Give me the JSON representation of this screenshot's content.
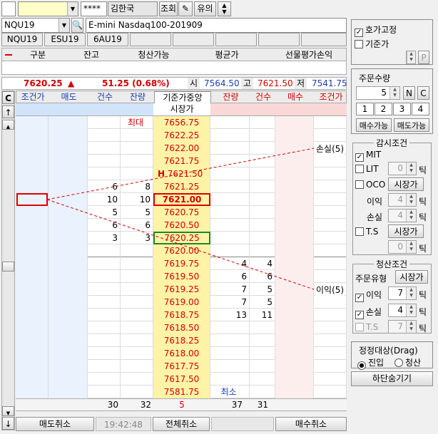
{
  "toolbar": {
    "account": "",
    "password": "****",
    "name": "김한국",
    "query": "조회",
    "notice": "유의"
  },
  "product": {
    "code": "NQU19",
    "desc": "E-mini Nasdaq100-201909",
    "tabs": [
      "NQU19",
      "ESU19",
      "6AU19",
      "",
      "",
      "",
      "",
      "",
      ""
    ]
  },
  "position_header": {
    "c1": "구분",
    "c2": "잔고",
    "c3": "청산가능",
    "c4": "평균가",
    "c5": "선물평가손익"
  },
  "quote": {
    "price": "7620.25",
    "arrow": "▲",
    "change": "51.25 (0.68%)",
    "open_label": "시",
    "open": "7564.50",
    "high_label": "고",
    "high": "7621.50",
    "low_label": "저",
    "low": "7541.75"
  },
  "grid_header": {
    "cond": "조건가",
    "sell": "매도",
    "cnt": "건수",
    "rem": "잔량",
    "ref": "기준가중앙",
    "rem2": "잔량",
    "cnt2": "건수",
    "buy": "매수",
    "cond2": "조건가",
    "corner": "C",
    "up": "↑",
    "down": "↓",
    "market": "시장가"
  },
  "rows": [
    {
      "rem": "최대",
      "price": "7656.75",
      "rem2": "",
      "cnt2": ""
    },
    {
      "rem": "",
      "price": "7622.25",
      "rem2": "",
      "cnt2": ""
    },
    {
      "rem": "",
      "price": "7622.00",
      "rem2": "",
      "cnt2": ""
    },
    {
      "rem": "",
      "price": "7621.75",
      "rem2": "",
      "cnt2": ""
    },
    {
      "rem": "",
      "price": "7621.50",
      "mark": "H",
      "rem2": "",
      "cnt2": ""
    },
    {
      "cnt": "6",
      "rem": "8",
      "price": "7621.25",
      "rem2": "",
      "cnt2": ""
    },
    {
      "cnt": "10",
      "rem": "10",
      "price": "7621.00",
      "rem2": "",
      "cnt2": ""
    },
    {
      "cnt": "5",
      "rem": "5",
      "price": "7620.75",
      "rem2": "",
      "cnt2": ""
    },
    {
      "cnt": "6",
      "rem": "6",
      "price": "7620.50",
      "rem2": "",
      "cnt2": ""
    },
    {
      "cnt": "3",
      "rem": "3",
      "price": "7620.25",
      "rem2": "",
      "cnt2": ""
    },
    {
      "cnt": "",
      "rem": "",
      "price": "7620.00",
      "rem2": "",
      "cnt2": ""
    },
    {
      "price": "7619.75",
      "rem2": "4",
      "cnt2": "4"
    },
    {
      "price": "7619.50",
      "rem2": "6",
      "cnt2": "6"
    },
    {
      "price": "7619.25",
      "rem2": "7",
      "cnt2": "5"
    },
    {
      "price": "7619.00",
      "rem2": "7",
      "cnt2": "5"
    },
    {
      "price": "7618.75",
      "rem2": "13",
      "cnt2": "11"
    },
    {
      "price": "7618.50",
      "rem2": "",
      "cnt2": ""
    },
    {
      "price": "7618.25",
      "rem2": "",
      "cnt2": ""
    },
    {
      "price": "7618.00",
      "rem2": "",
      "cnt2": ""
    },
    {
      "price": "7617.75",
      "rem2": "",
      "cnt2": ""
    },
    {
      "price": "7617.50",
      "rem2": "",
      "cnt2": ""
    },
    {
      "price": "7581.75",
      "rem2": "최소",
      "cnt2": ""
    }
  ],
  "totals": {
    "cnt": "30",
    "rem": "32",
    "mid": "5",
    "rem2": "37",
    "cnt2": "31"
  },
  "bottom": {
    "sell_cancel": "매도취소",
    "time": "19:42:48",
    "all_cancel": "전체취소",
    "buy_cancel": "매수취소"
  },
  "annotations": {
    "loss": "손실(5)",
    "profit": "이익(5)"
  },
  "side": {
    "fix_quote": "호가고정",
    "base_price": "기준가",
    "p_btn": "P",
    "qty_title": "주문수량",
    "qty": "5",
    "n_btn": "N",
    "c_btn": "C",
    "presets": [
      "1",
      "2",
      "3",
      "4"
    ],
    "buy_avail": "매수가능",
    "sell_avail": "매도가능",
    "watch_title": "감시조건",
    "mit": "MIT",
    "lit": "LIT",
    "oco": "OCO",
    "ts": "T.S",
    "market": "시장가",
    "tick": "틱",
    "lit_val": "0",
    "profit_label": "이익",
    "profit_val": "4",
    "loss_label": "손실",
    "loss_val": "4",
    "ts_val": "0",
    "liq_title": "청산조건",
    "order_type": "주문유형",
    "order_type_val": "시장가",
    "liq_profit": "이익",
    "liq_profit_val": "7",
    "liq_loss": "손실",
    "liq_loss_val": "4",
    "liq_ts": "T.S",
    "liq_ts_val": "7",
    "drag_title": "정정대상(Drag)",
    "entry": "진입",
    "exit": "청산",
    "hide": "하단숨기기"
  }
}
